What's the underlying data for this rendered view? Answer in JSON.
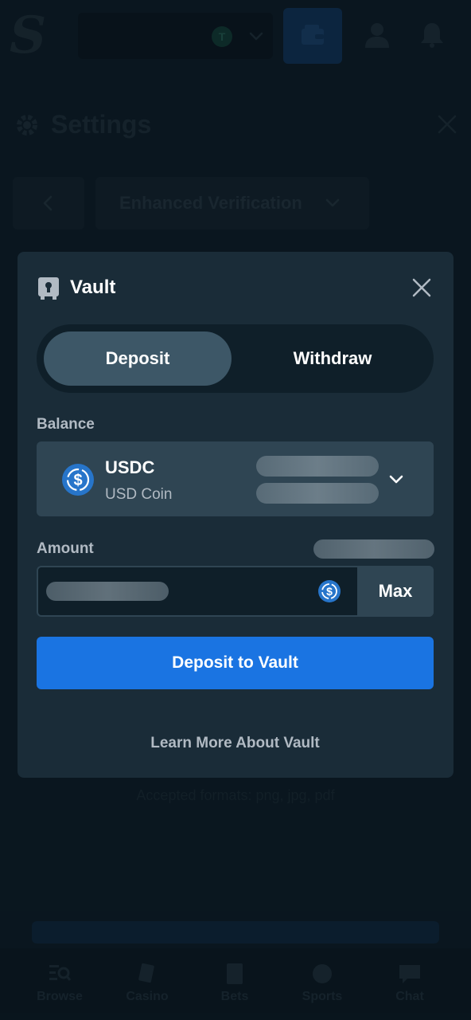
{
  "background": {
    "logo_letter": "S",
    "avatar_badge": "T",
    "settings_title": "Settings",
    "verification_select": "Enhanced Verification",
    "accepted_formats": "Accepted formats: png, jpg, pdf",
    "nav": [
      {
        "label": "Browse",
        "icon": "browse-icon"
      },
      {
        "label": "Casino",
        "icon": "cards-icon"
      },
      {
        "label": "Bets",
        "icon": "betslip-icon"
      },
      {
        "label": "Sports",
        "icon": "basketball-icon"
      },
      {
        "label": "Chat",
        "icon": "chat-icon"
      }
    ]
  },
  "vault": {
    "title": "Vault",
    "tabs": {
      "deposit": "Deposit",
      "withdraw": "Withdraw",
      "active": "Deposit"
    },
    "balance_label": "Balance",
    "currency": {
      "symbol": "USDC",
      "name": "USD Coin",
      "icon": "usdc-icon"
    },
    "amount_label": "Amount",
    "max_label": "Max",
    "submit_label": "Deposit to Vault",
    "learn_more": "Learn More About Vault"
  },
  "colors": {
    "accent_blue": "#1a74e2",
    "modal_bg": "#1a2c38",
    "card_bg": "#2f4553",
    "active_tab": "#3d5767",
    "usdc_blue": "#2775ca"
  }
}
